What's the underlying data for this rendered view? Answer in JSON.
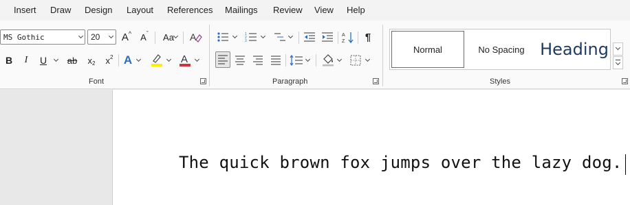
{
  "menu": [
    "Insert",
    "Draw",
    "Design",
    "Layout",
    "References",
    "Mailings",
    "Review",
    "View",
    "Help"
  ],
  "font": {
    "name": "MS Gothic",
    "size": "20",
    "group_label": "Font",
    "buttons": {
      "grow": "A",
      "shrink": "A",
      "change_case": "Aa",
      "bold": "B",
      "italic": "I",
      "underline": "U",
      "strike": "ab",
      "subscript": "x",
      "subscript_sub": "2",
      "superscript": "x",
      "superscript_sup": "2",
      "text_effects": "A",
      "font_color": "A"
    },
    "highlight_color": "#ffee00",
    "font_color_value": "#d13438"
  },
  "paragraph": {
    "group_label": "Paragraph",
    "show_marks": "¶"
  },
  "styles": {
    "group_label": "Styles",
    "items": [
      "Normal",
      "No Spacing",
      "Heading"
    ]
  },
  "document": {
    "text": "The quick brown fox jumps over the lazy dog."
  }
}
